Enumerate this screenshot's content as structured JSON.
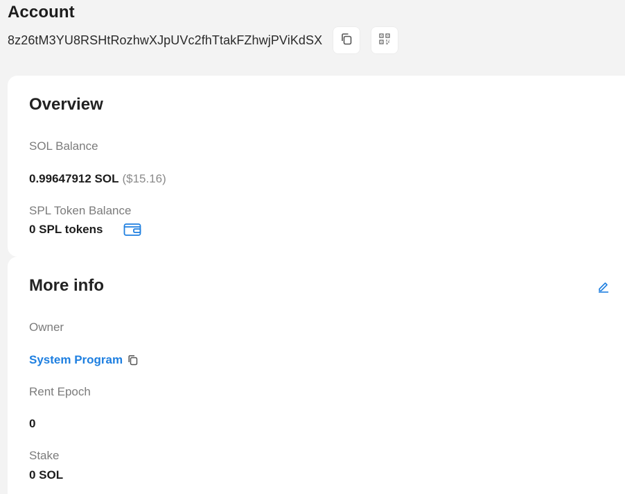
{
  "header": {
    "title": "Account",
    "address": "8z26tM3YU8RSHtRozhwXJpUVc2fhTtakFZhwjPViKdSX",
    "copy_icon": "copy-icon",
    "qr_icon": "qr-code-icon"
  },
  "overview": {
    "title": "Overview",
    "sol_balance_label": "SOL Balance",
    "sol_balance_value": "0.99647912 SOL",
    "sol_balance_usd": "($15.16)",
    "spl_label": "SPL Token Balance",
    "spl_value": "0 SPL tokens",
    "wallet_icon": "wallet-icon"
  },
  "more_info": {
    "title": "More info",
    "edit_icon": "edit-pencil-icon",
    "owner_label": "Owner",
    "owner_value": "System Program",
    "rent_epoch_label": "Rent Epoch",
    "rent_epoch_value": "0",
    "stake_label": "Stake",
    "stake_value": "0 SOL"
  },
  "colors": {
    "background": "#f3f3f3",
    "card": "#ffffff",
    "link": "#1e7fe0",
    "label": "#7b7b7b"
  }
}
